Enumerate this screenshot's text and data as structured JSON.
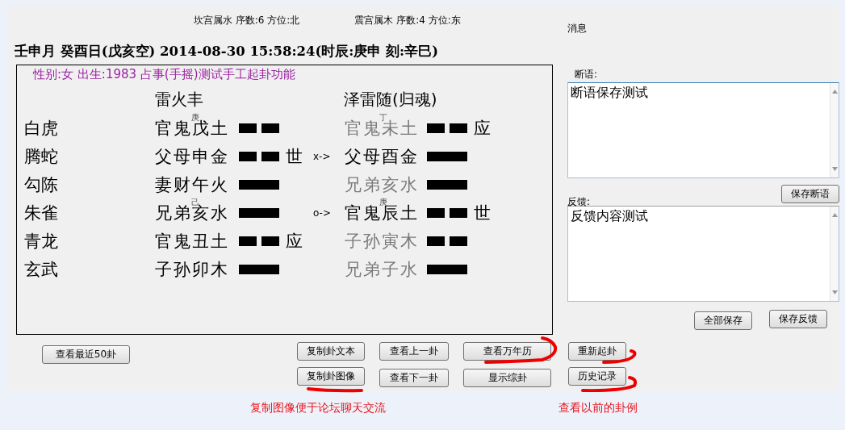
{
  "palace_info": [
    "坎宫属水 序数:6 方位:北",
    "震宫属木 序数:4 方位:东"
  ],
  "datetime": "壬申月 癸酉日(戊亥空) 2014-08-30 15:58:24(时辰:庚申 刻:辛巳)",
  "chart": {
    "info": "性别:女 出生:1983 占事(手摇)测试手工起卦功能",
    "main_name": "雷火丰",
    "changed_name": "泽雷随(归魂)",
    "rows": [
      {
        "spirit": "白虎",
        "main": {
          "text": "官鬼戊土",
          "kind": "yin",
          "hidden": "庚"
        },
        "changed": {
          "text": "官鬼未土",
          "kind": "yin",
          "mark": "应",
          "hidden": "丁",
          "dim": true
        }
      },
      {
        "spirit": "腾蛇",
        "main": {
          "text": "父母申金",
          "kind": "yin",
          "mark": "世"
        },
        "change": "x->",
        "changed": {
          "text": "父母酉金",
          "kind": "yang",
          "dim": false
        }
      },
      {
        "spirit": "勾陈",
        "main": {
          "text": "妻财午火",
          "kind": "yang"
        },
        "changed": {
          "text": "兄弟亥水",
          "kind": "yang",
          "dim": true
        }
      },
      {
        "spirit": "朱雀",
        "main": {
          "text": "兄弟亥水",
          "kind": "yang",
          "hidden": "己"
        },
        "change": "o->",
        "changed": {
          "text": "官鬼辰土",
          "kind": "yin",
          "mark": "世",
          "hidden": "庚",
          "dim": false
        }
      },
      {
        "spirit": "青龙",
        "main": {
          "text": "官鬼丑土",
          "kind": "yin",
          "mark": "应"
        },
        "changed": {
          "text": "子孙寅木",
          "kind": "yin",
          "dim": true
        }
      },
      {
        "spirit": "玄武",
        "main": {
          "text": "子孙卯木",
          "kind": "yang"
        },
        "changed": {
          "text": "兄弟子水",
          "kind": "yang",
          "dim": true
        }
      }
    ]
  },
  "message_label": "消息",
  "judgement": {
    "label": "断语:",
    "value": "断语保存测试",
    "button": "保存断语"
  },
  "feedback": {
    "label": "反馈:",
    "value": "反馈内容测试",
    "buttons": [
      "全部保存",
      "保存反馈"
    ]
  },
  "buttons": {
    "recent": "查看最近50卦",
    "copy_text": "复制卦文本",
    "copy_image": "复制卦图像",
    "prev": "查看上一卦",
    "next": "查看下一卦",
    "calendar": "查看万年历",
    "show_zong": "显示综卦",
    "restart": "重新起卦",
    "history": "历史记录"
  },
  "annotations": [
    "复制图像便于论坛聊天交流",
    "查看以前的卦例"
  ]
}
